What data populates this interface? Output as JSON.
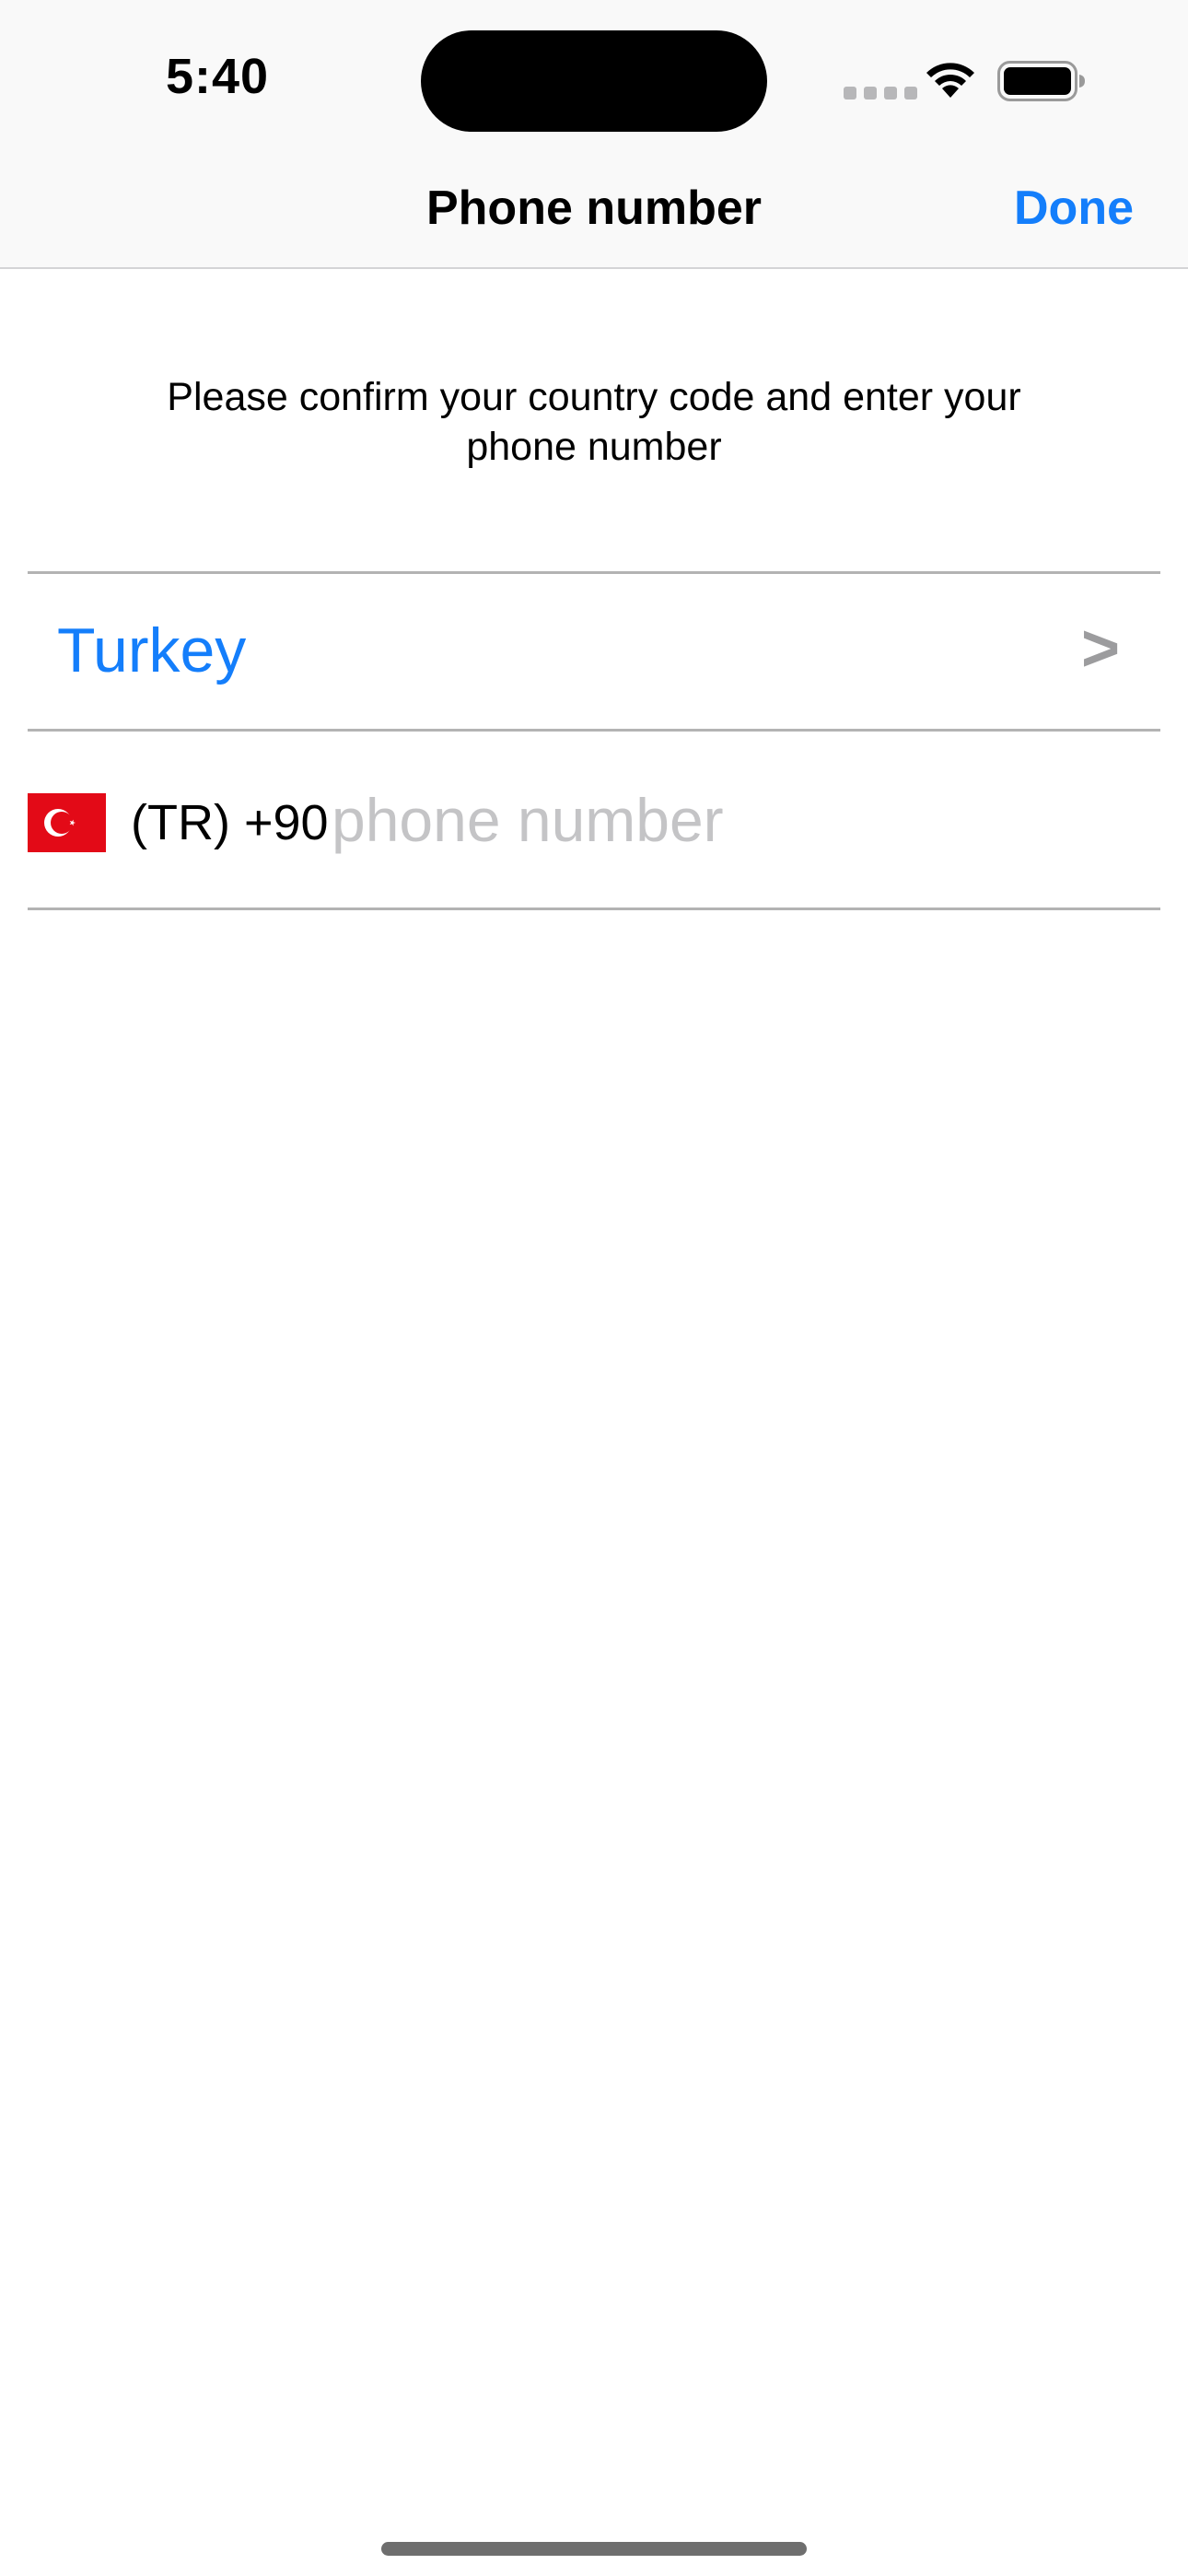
{
  "status_bar": {
    "time": "5:40"
  },
  "nav": {
    "title": "Phone number",
    "done_label": "Done"
  },
  "instruction": "Please confirm your country code and enter your phone number",
  "country": {
    "name": "Turkey",
    "chevron": ">"
  },
  "phone": {
    "code_label": "(TR) +90",
    "value": "",
    "placeholder": "phone number"
  },
  "colors": {
    "accent": "#147efb",
    "flag_red": "#e30a17",
    "placeholder": "#c4c4c6",
    "divider": "#b3b3b3"
  },
  "icons": {
    "wifi": "wifi-icon",
    "battery": "battery-icon",
    "flag": "turkey-flag-icon",
    "chevron": "chevron-right-icon"
  }
}
